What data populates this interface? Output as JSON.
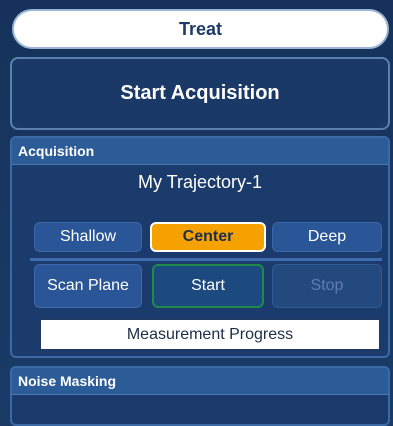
{
  "treat": {
    "label": "Treat"
  },
  "start_acquisition": {
    "label": "Start Acquisition"
  },
  "acquisition": {
    "header": "Acquisition",
    "trajectory": "My Trajectory-1",
    "depth": {
      "shallow": "Shallow",
      "center": "Center",
      "deep": "Deep",
      "selected": "Center"
    },
    "scan_plane": "Scan Plane",
    "start": "Start",
    "stop": "Stop",
    "progress_label": "Measurement Progress"
  },
  "noise_masking": {
    "header": "Noise Masking"
  },
  "colors": {
    "panel": "#1a3966",
    "accent_selected": "#f5a200",
    "start_border": "#1f8a4e"
  }
}
